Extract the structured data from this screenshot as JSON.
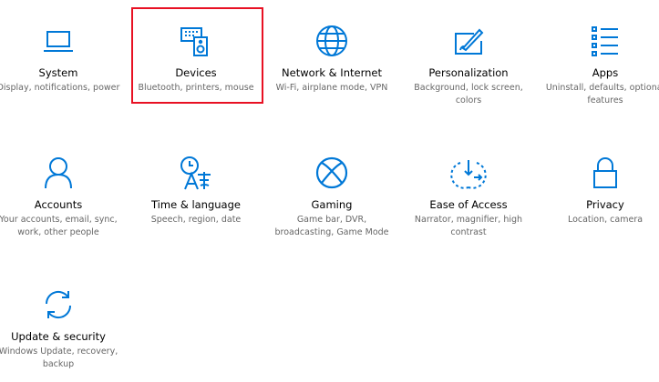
{
  "accent_color": "#0078d7",
  "highlight_color": "#e81123",
  "tiles": [
    {
      "title": "System",
      "desc": "Display, notifications, power",
      "icon": "laptop-icon"
    },
    {
      "title": "Devices",
      "desc": "Bluetooth, printers, mouse",
      "icon": "keyboard-speaker-icon",
      "selected": true
    },
    {
      "title": "Network & Internet",
      "desc": "Wi-Fi, airplane mode, VPN",
      "icon": "globe-icon"
    },
    {
      "title": "Personalization",
      "desc": "Background, lock screen, colors",
      "icon": "paintbrush-icon"
    },
    {
      "title": "Apps",
      "desc": "Uninstall, defaults, optional features",
      "icon": "apps-list-icon"
    },
    {
      "title": "Accounts",
      "desc": "Your accounts, email, sync, work, other people",
      "icon": "person-icon"
    },
    {
      "title": "Time & language",
      "desc": "Speech, region, date",
      "icon": "time-language-icon"
    },
    {
      "title": "Gaming",
      "desc": "Game bar, DVR, broadcasting, Game Mode",
      "icon": "xbox-icon"
    },
    {
      "title": "Ease of Access",
      "desc": "Narrator, magnifier, high contrast",
      "icon": "ease-of-access-icon"
    },
    {
      "title": "Privacy",
      "desc": "Location, camera",
      "icon": "lock-icon"
    },
    {
      "title": "Update & security",
      "desc": "Windows Update, recovery, backup",
      "icon": "sync-arrows-icon"
    }
  ]
}
